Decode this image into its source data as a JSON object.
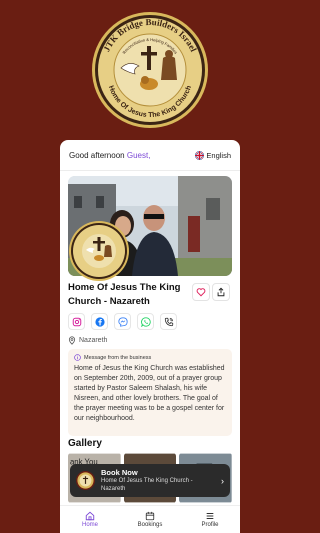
{
  "logo": {
    "arc_top": "JTK Bridge Builders Israel",
    "arc_mid": "Reconciliation & Helping Families",
    "arc_bottom": "Home Of Jesus The King Church"
  },
  "header": {
    "greeting": "Good afternoon",
    "user": "Guest,",
    "language": "English"
  },
  "church": {
    "name": "Home Of Jesus The King Church - Nazareth",
    "location": "Nazareth"
  },
  "message": {
    "heading": "Message from the business",
    "body": "Home of Jesus the King Church was established on September 20th, 2009, out of a prayer group started by Pastor Saleem Shalash, his wife Nisreen, and other lovely brothers. The goal of the prayer meeting was to be a gospel center for our neighbourhood."
  },
  "gallery": {
    "title": "Gallery",
    "first_image_text": "ank You"
  },
  "book_now": {
    "title": "Book Now",
    "subtitle": "Home Of Jesus The King Church - Nazareth"
  },
  "tabs": [
    {
      "label": "Home"
    },
    {
      "label": "Bookings"
    },
    {
      "label": "Profile"
    }
  ],
  "colors": {
    "background": "#6a1e12",
    "accent": "#7c4ad6",
    "logo_gold": "#d9b85c"
  }
}
